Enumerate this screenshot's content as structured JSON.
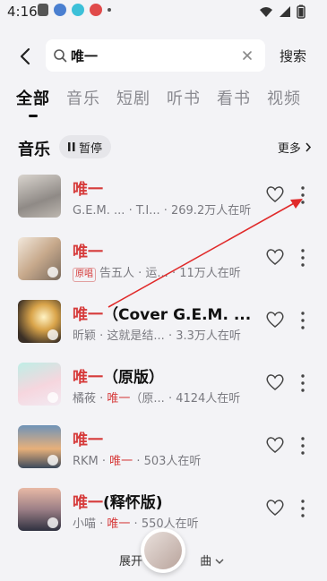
{
  "status_bar": {
    "time": "4:16"
  },
  "search": {
    "query": "唯一",
    "submit_label": "搜索"
  },
  "tabs": [
    {
      "label": "全部",
      "active": true
    },
    {
      "label": "音乐"
    },
    {
      "label": "短剧"
    },
    {
      "label": "听书"
    },
    {
      "label": "看书"
    },
    {
      "label": "视频"
    }
  ],
  "music_section": {
    "title": "音乐",
    "pause_label": "暂停",
    "more_label": "更多"
  },
  "songs": [
    {
      "title_hl": "唯一",
      "title_rest": "",
      "sub_pre": "G.E.M. ... · T.I... ",
      "sub_hl": "",
      "sub_post": "· 269.2万人在听",
      "badge": ""
    },
    {
      "title_hl": "唯一",
      "title_rest": "",
      "sub_pre": "告五人 · 运... ",
      "sub_hl": "",
      "sub_post": "· 11万人在听",
      "badge": "原唱"
    },
    {
      "title_hl": "唯一",
      "title_rest": "（Cover G.E.M. ...",
      "sub_pre": "昕颖 · 这就是结... ",
      "sub_hl": "",
      "sub_post": "· 3.3万人在听",
      "badge": ""
    },
    {
      "title_hl": "唯一",
      "title_rest": "（原版）",
      "sub_pre": "橘莜 · ",
      "sub_hl": "唯一",
      "sub_post": "（原... · 4124人在听",
      "badge": ""
    },
    {
      "title_hl": "唯一",
      "title_rest": "",
      "sub_pre": "RKM · ",
      "sub_hl": "唯一",
      "sub_post": " · 503人在听",
      "badge": ""
    },
    {
      "title_hl": "唯一",
      "title_rest": "(释怀版)",
      "sub_pre": "小喵 · ",
      "sub_hl": "唯一",
      "sub_post": " · 550人在听",
      "badge": ""
    }
  ],
  "expand": {
    "pre": "展开",
    "post": "曲"
  },
  "colors": {
    "highlight": "#d63b3b",
    "annotation_arrow": "#e02a2a",
    "background": "#f3f3f6"
  }
}
